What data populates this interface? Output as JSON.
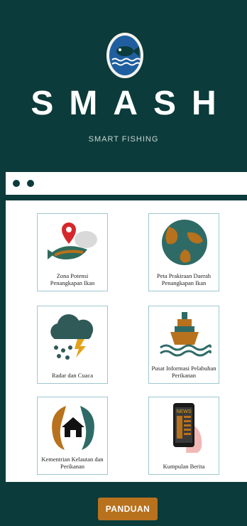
{
  "app": {
    "title": "SMASH",
    "subtitle": "SMART FISHING"
  },
  "menu": [
    {
      "label": "Zona Potensi Penangkapan Ikan",
      "icon": "fish-location-icon"
    },
    {
      "label": "Peta Prakiraan Daerah Penangkapan Ikan",
      "icon": "globe-icon"
    },
    {
      "label": "Radar dan Cuaca",
      "icon": "storm-cloud-icon"
    },
    {
      "label": "Pusat Informasi Pelabuhan Perikanan",
      "icon": "ship-icon"
    },
    {
      "label": "Kementrian Kelautan dan Perikanan",
      "icon": "ministry-fish-house-icon"
    },
    {
      "label": "Kumpulan Berita",
      "icon": "news-phone-icon"
    }
  ],
  "news_icon_text": "NEWS",
  "footer": {
    "button_label": "PANDUAN"
  },
  "colors": {
    "background": "#0b3b3a",
    "accent": "#b8711d",
    "tile_border": "#9ec7d0"
  }
}
